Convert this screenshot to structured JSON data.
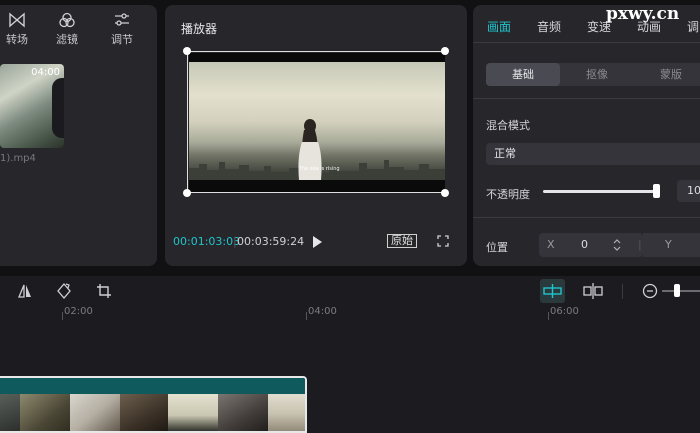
{
  "media_panel": {
    "tools": [
      {
        "label": "转场",
        "icon": "transition-icon"
      },
      {
        "label": "滤镜",
        "icon": "filter-icon"
      },
      {
        "label": "调节",
        "icon": "adjust-icon"
      }
    ],
    "clip": {
      "duration": "04:00",
      "filename": "1).mp4"
    }
  },
  "player": {
    "title": "播放器",
    "current_time": "00:01:03:03",
    "separator": "|",
    "total_time": "00:03:59:24",
    "original_label": "原始",
    "subtitle_text": "The sea is rising"
  },
  "inspector": {
    "tabs": [
      {
        "label": "画面",
        "active": true
      },
      {
        "label": "音频",
        "active": false
      },
      {
        "label": "变速",
        "active": false
      },
      {
        "label": "动画",
        "active": false
      },
      {
        "label": "调",
        "active": false
      }
    ],
    "segments": [
      {
        "label": "基础",
        "active": true
      },
      {
        "label": "抠像",
        "active": false
      },
      {
        "label": "蒙版",
        "active": false
      }
    ],
    "blend_mode_label": "混合模式",
    "blend_mode_value": "正常",
    "opacity_label": "不透明度",
    "opacity_value": "10",
    "opacity_level": 0.99,
    "position_label": "位置",
    "pos_x_label": "X",
    "pos_x_value": "0",
    "pos_y_label": "Y"
  },
  "watermark": "pxwy.cn",
  "timeline": {
    "ruler_ticks": [
      "02:00",
      "04:00",
      "06:00"
    ],
    "clip_color": "#0f5a5c"
  },
  "colors": {
    "accent": "#20c4cc",
    "panel": "#26262b",
    "background": "#111114"
  }
}
